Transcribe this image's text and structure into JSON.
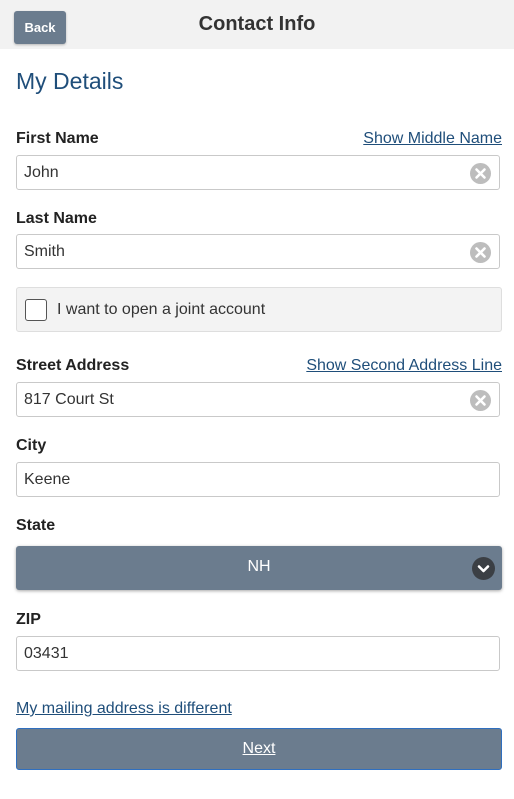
{
  "header": {
    "back_label": "Back",
    "title": "Contact Info"
  },
  "page_title": "My Details",
  "first_name": {
    "label": "First Name",
    "value": "John",
    "link": "Show Middle Name"
  },
  "last_name": {
    "label": "Last Name",
    "value": "Smith"
  },
  "joint_account": {
    "label": "I want to open a joint account",
    "checked": false
  },
  "street": {
    "label": "Street Address",
    "value": "817 Court St",
    "link": "Show Second Address Line"
  },
  "city": {
    "label": "City",
    "value": "Keene"
  },
  "state": {
    "label": "State",
    "value": "NH"
  },
  "zip": {
    "label": "ZIP",
    "value": "03431"
  },
  "mailing_link": "My mailing address is different",
  "next_label": "Next",
  "colors": {
    "accent": "#6b7c8e",
    "title_blue": "#1f4e7a",
    "focus_border": "#2f6fbf"
  },
  "icons": {
    "clear": "clear-circle-x-icon",
    "dropdown": "chevron-down-icon"
  }
}
